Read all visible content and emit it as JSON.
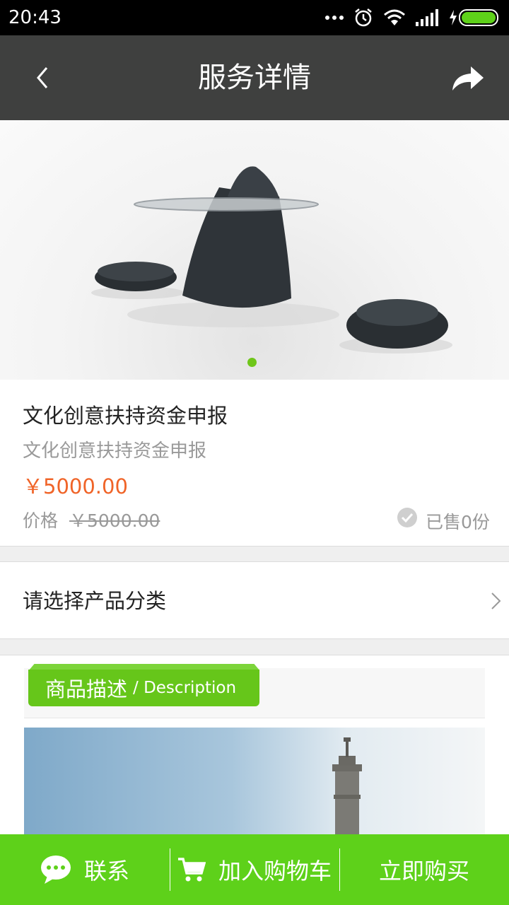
{
  "status_bar": {
    "time": "20:43"
  },
  "header": {
    "title": "服务详情"
  },
  "product": {
    "title": "文化创意扶持资金申报",
    "subtitle": "文化创意扶持资金申报",
    "price": "￥5000.00",
    "price_label": "价格",
    "original_price": "￥5000.00",
    "sold": "已售0份"
  },
  "category": {
    "label": "请选择产品分类"
  },
  "description": {
    "title_cn": "商品描述",
    "title_en": "/ Description"
  },
  "bottom_bar": {
    "contact": "联系",
    "add_to_cart": "加入购物车",
    "buy_now": "立即购买"
  },
  "colors": {
    "accent_green": "#5ed11a",
    "price_orange": "#f06428",
    "header_bg": "#3f403f"
  },
  "icons": [
    "back-icon",
    "share-icon",
    "chat-icon",
    "cart-icon",
    "check-circle-icon",
    "chevron-right-icon"
  ]
}
